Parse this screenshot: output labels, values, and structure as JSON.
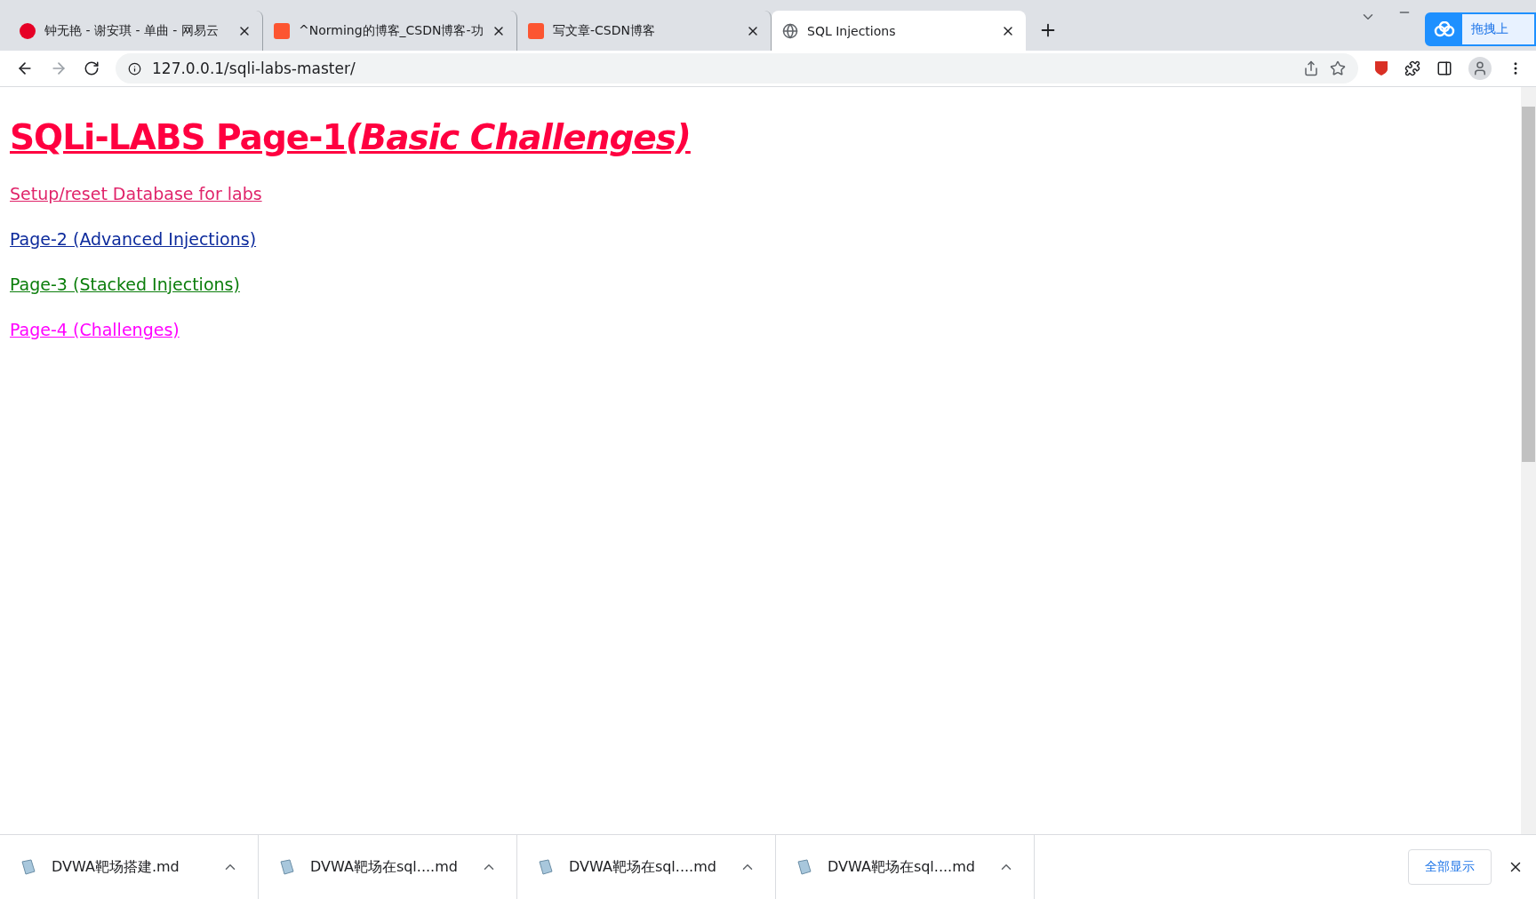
{
  "tabs": [
    {
      "kind": "music",
      "title": "钟无艳 - 谢安琪 - 单曲 - 网易云",
      "selected": false
    },
    {
      "kind": "csdn",
      "title": "^Norming的博客_CSDN博客-功",
      "selected": false
    },
    {
      "kind": "csdn",
      "title": "写文章-CSDN博客",
      "selected": false
    },
    {
      "kind": "globe",
      "title": "SQL Injections",
      "selected": true
    }
  ],
  "upload_button": "拖拽上",
  "address_bar": {
    "url": "127.0.0.1/sqli-labs-master/"
  },
  "page": {
    "heading": "SQLi-LABS Page-1",
    "heading_italic": "(Basic Challenges)",
    "links": [
      {
        "text": "Setup/reset Database for labs",
        "color": "#e0246a"
      },
      {
        "text": "Page-2 (Advanced Injections)",
        "color": "#0c2a9c"
      },
      {
        "text": "Page-3 (Stacked Injections)",
        "color": "#0a7d0a"
      },
      {
        "text": "Page-4 (Challenges)",
        "color": "#ff00ff"
      }
    ]
  },
  "downloads": {
    "items": [
      {
        "name": "DVWA靶场搭建.md"
      },
      {
        "name": "DVWA靶场在sql....md"
      },
      {
        "name": "DVWA靶场在sql....md"
      },
      {
        "name": "DVWA靶场在sql....md"
      }
    ],
    "show_all": "全部显示"
  }
}
